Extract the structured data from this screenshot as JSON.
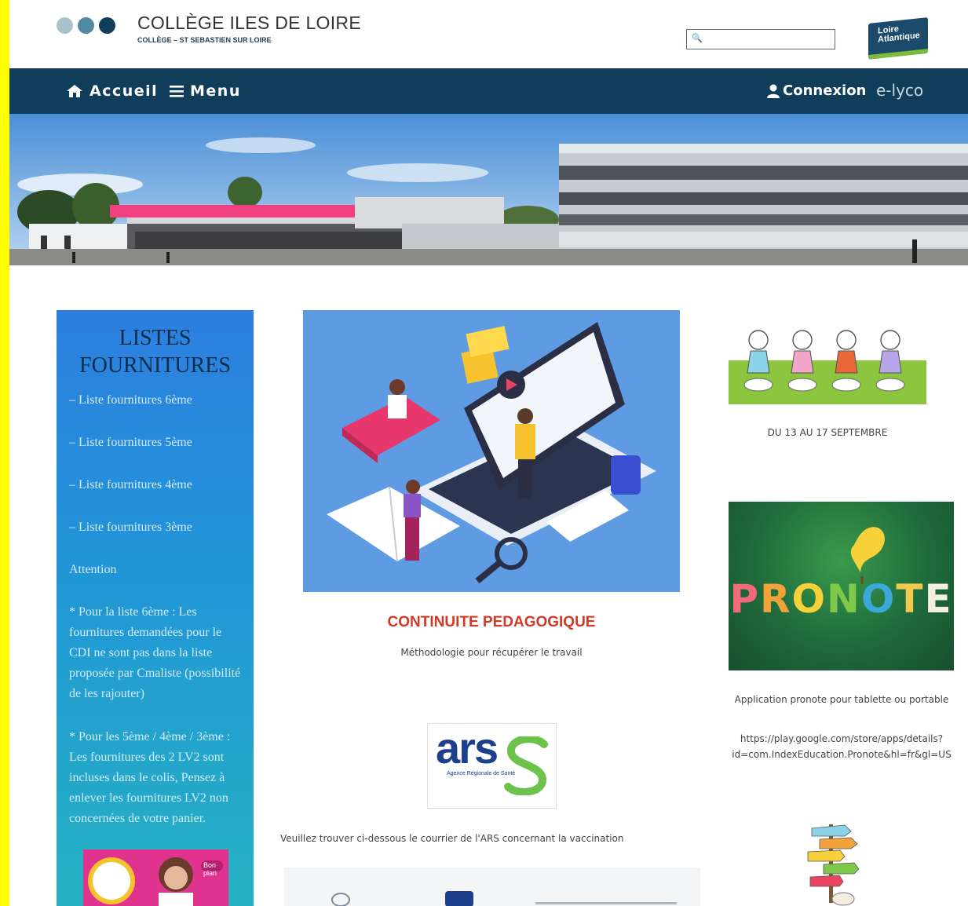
{
  "header": {
    "title": "COLLÈGE ILES DE LOIRE",
    "subtitle": "COLLÈGE – ST SEBASTIEN SUR LOIRE",
    "search_placeholder": "",
    "partner_logo_text_1": "Loire",
    "partner_logo_text_2": "Atlantique",
    "dot_colors": [
      "#a9c1cc",
      "#4f8aa0",
      "#0f3d5a"
    ]
  },
  "nav": {
    "home_label": "Accueil",
    "menu_label": "Menu",
    "login_label": "Connexion",
    "elyco_label": "e-lyco",
    "home_icon": "home-icon",
    "menu_icon": "hamburger-icon",
    "login_icon": "user-icon"
  },
  "sidebar": {
    "title_line1": "LISTES",
    "title_line2": "FOURNITURES",
    "items": [
      "– Liste fournitures 6ème",
      "– Liste fournitures 5ème",
      "– Liste fournitures 4ème",
      "– Liste fournitures 3ème"
    ],
    "attention": "Attention",
    "note_6eme": "* Pour la liste 6ème : Les fournitures demandées pour le CDI ne sont pas dans la liste proposée par Cmaliste (possibilité de les rajouter)",
    "note_autres": "* Pour les 5ème / 4ème / 3ème  : Les fournitures des 2 LV2 sont incluses dans le colis, Pensez à enlever les fournitures  LV2 non concernées de votre panier.",
    "promo_label": "Bon plan"
  },
  "center": {
    "continuite_title": "CONTINUITE PEDAGOGIQUE",
    "continuite_sub": "Méthodologie pour récupérer le travail",
    "ars_logo_text": "ars",
    "ars_logo_caption": "Agence Régionale de Santé",
    "ars_text": "Veuillez trouver ci-dessous le courrier de l'ARS concernant la vaccination"
  },
  "right": {
    "date_text": "DU 13 AU 17 SEPTEMBRE",
    "pronote_letters": [
      "P",
      "R",
      "O",
      "N",
      "O",
      "T",
      "E"
    ],
    "pronote_colors": [
      "#f06a7a",
      "#f2a23a",
      "#f6d13a",
      "#7ec84a",
      "#3aa9d8",
      "#f2c94c",
      "#f4efe0"
    ],
    "app_text": "Application pronote pour tablette ou portable",
    "app_url": "https://play.google.com/store/apps/details?id=com.IndexEducation.Pronote&hl=fr&gl=US",
    "app_url_line1": "https://play.google.com/store/apps/details?",
    "app_url_line2": "id=com.IndexEducation.Pronote&hl=fr&gl=US"
  }
}
